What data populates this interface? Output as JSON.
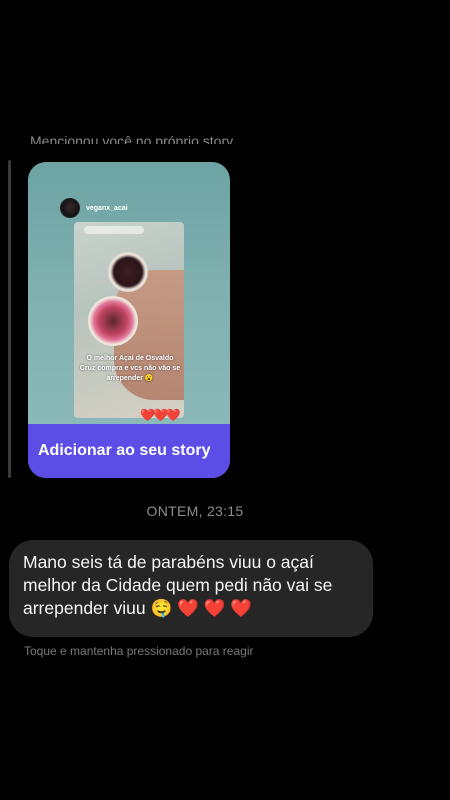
{
  "chat": {
    "mention_note": "Mencionou você no próprio story",
    "story": {
      "username": "veganx_acai",
      "caption": "O melhor Açaí de Osvaldo Cruz  compra e vcs não vão se arrepender 😮",
      "hearts": "❤️❤️❤️",
      "add_button_label": "Adicionar ao seu story"
    },
    "timestamp": "ONTEM, 23:15",
    "message": {
      "text": "Mano seis tá de parabéns viuu o açaí melhor da Cidade quem pedi não vai se arrepender viuu 🤤 ❤️ ❤️ ❤️"
    },
    "hold_hint": "Toque e mantenha pressionado para reagir"
  }
}
